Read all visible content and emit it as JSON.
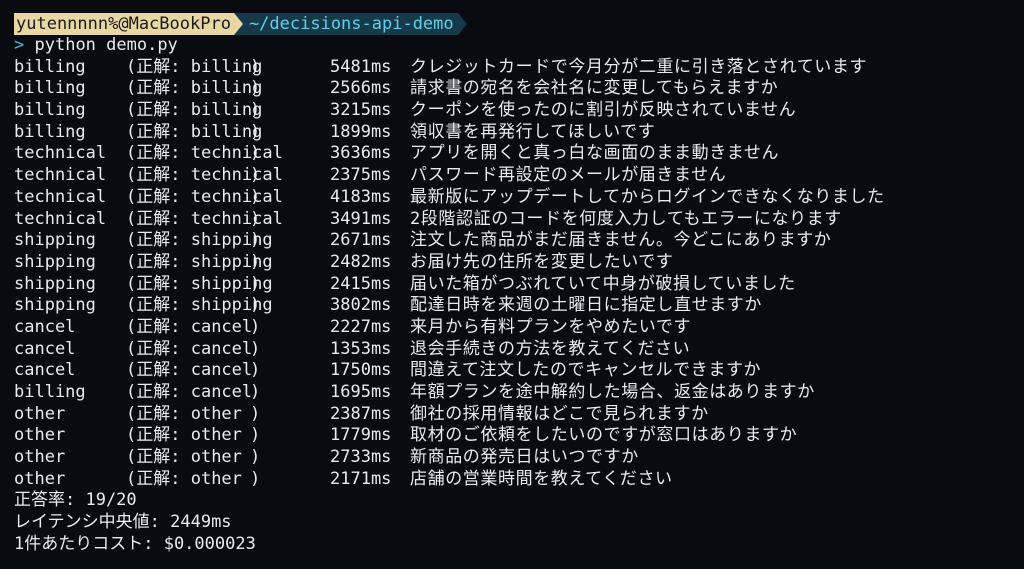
{
  "prompt": {
    "user_host": "yutennnnn%@MacBookPro",
    "path": "~/decisions-api-demo",
    "prompt_char": ">",
    "command": "python demo.py"
  },
  "labels": {
    "correct_prefix": "(正解: ",
    "close": ")"
  },
  "results": [
    {
      "pred": "billing",
      "truth": "billing",
      "latency": "5481ms",
      "text": "クレジットカードで今月分が二重に引き落とされています"
    },
    {
      "pred": "billing",
      "truth": "billing",
      "latency": "2566ms",
      "text": "請求書の宛名を会社名に変更してもらえますか"
    },
    {
      "pred": "billing",
      "truth": "billing",
      "latency": "3215ms",
      "text": "クーポンを使ったのに割引が反映されていません"
    },
    {
      "pred": "billing",
      "truth": "billing",
      "latency": "1899ms",
      "text": "領収書を再発行してほしいです"
    },
    {
      "pred": "technical",
      "truth": "technical",
      "latency": "3636ms",
      "text": "アプリを開くと真っ白な画面のまま動きません"
    },
    {
      "pred": "technical",
      "truth": "technical",
      "latency": "2375ms",
      "text": "パスワード再設定のメールが届きません"
    },
    {
      "pred": "technical",
      "truth": "technical",
      "latency": "4183ms",
      "text": "最新版にアップデートしてからログインできなくなりました"
    },
    {
      "pred": "technical",
      "truth": "technical",
      "latency": "3491ms",
      "text": "2段階認証のコードを何度入力してもエラーになります"
    },
    {
      "pred": "shipping",
      "truth": "shipping",
      "latency": "2671ms",
      "text": "注文した商品がまだ届きません。今どこにありますか"
    },
    {
      "pred": "shipping",
      "truth": "shipping",
      "latency": "2482ms",
      "text": "お届け先の住所を変更したいです"
    },
    {
      "pred": "shipping",
      "truth": "shipping",
      "latency": "2415ms",
      "text": "届いた箱がつぶれていて中身が破損していました"
    },
    {
      "pred": "shipping",
      "truth": "shipping",
      "latency": "3802ms",
      "text": "配達日時を来週の土曜日に指定し直せますか"
    },
    {
      "pred": "cancel",
      "truth": "cancel",
      "latency": "2227ms",
      "text": "来月から有料プランをやめたいです"
    },
    {
      "pred": "cancel",
      "truth": "cancel",
      "latency": "1353ms",
      "text": "退会手続きの方法を教えてください"
    },
    {
      "pred": "cancel",
      "truth": "cancel",
      "latency": "1750ms",
      "text": "間違えて注文したのでキャンセルできますか"
    },
    {
      "pred": "billing",
      "truth": "cancel",
      "latency": "1695ms",
      "text": "年額プランを途中解約した場合、返金はありますか"
    },
    {
      "pred": "other",
      "truth": "other",
      "latency": "2387ms",
      "text": "御社の採用情報はどこで見られますか"
    },
    {
      "pred": "other",
      "truth": "other",
      "latency": "1779ms",
      "text": "取材のご依頼をしたいのですが窓口はありますか"
    },
    {
      "pred": "other",
      "truth": "other",
      "latency": "2733ms",
      "text": "新商品の発売日はいつですか"
    },
    {
      "pred": "other",
      "truth": "other",
      "latency": "2171ms",
      "text": "店舗の営業時間を教えてください"
    }
  ],
  "summary": {
    "accuracy": "正答率: 19/20",
    "median_latency": "レイテンシ中央値: 2449ms",
    "cost_per_item": "1件あたりコスト: $0.000023"
  },
  "colors": {
    "background": "#0a0b10",
    "foreground": "#e9ebf0",
    "user_segment_bg": "#e9d7a3",
    "path_segment_bg": "#173a4a",
    "path_text": "#5fd0ea",
    "prompt_char": "#4fb6e8"
  }
}
